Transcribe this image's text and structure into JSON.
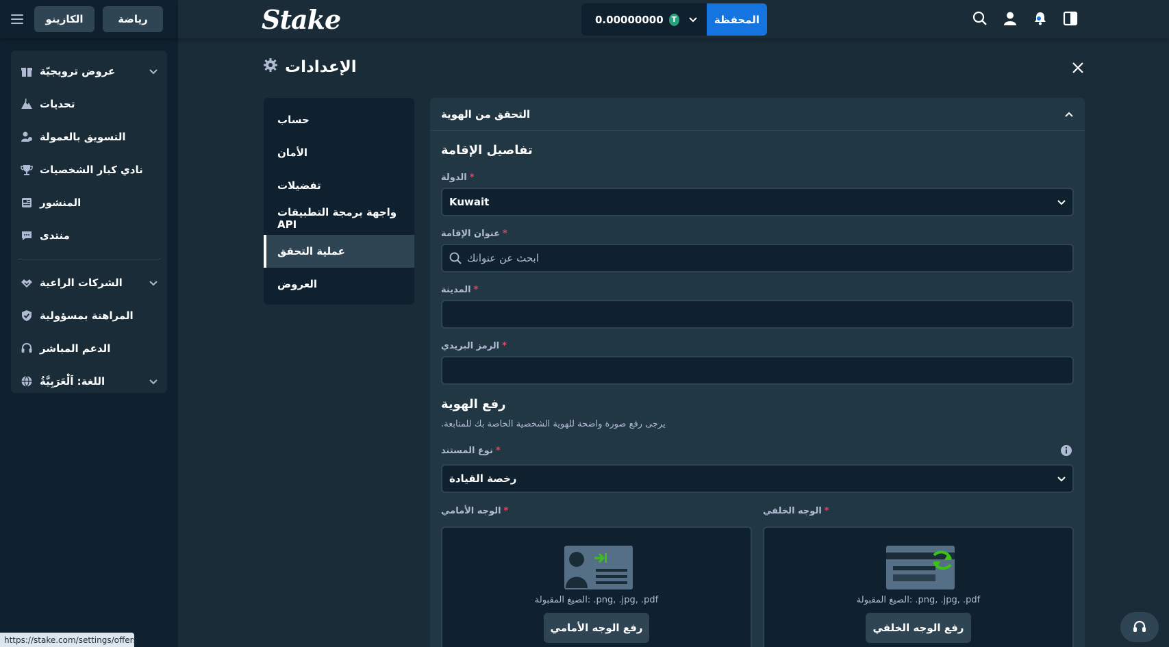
{
  "sidebar": {
    "tabs": {
      "casino": "الكازينو",
      "sports": "رياضة"
    },
    "items": [
      {
        "label": "عروض ترويجيّة",
        "icon": "gift-icon",
        "has_chevron": true
      },
      {
        "label": "تحديات",
        "icon": "mountain-icon",
        "has_chevron": false
      },
      {
        "label": "التسويق بالعمولة",
        "icon": "affiliate-icon",
        "has_chevron": false
      },
      {
        "label": "نادي كبار الشخصيات",
        "icon": "trophy-icon",
        "has_chevron": false
      },
      {
        "label": "المنشور",
        "icon": "newspaper-icon",
        "has_chevron": false
      },
      {
        "label": "منتدى",
        "icon": "chat-icon",
        "has_chevron": false
      }
    ],
    "items2": [
      {
        "label": "الشركات الراعية",
        "icon": "handshake-icon",
        "has_chevron": true
      },
      {
        "label": "المراهنة بمسؤولية",
        "icon": "shield-icon",
        "has_chevron": false
      },
      {
        "label": "الدعم المباشر",
        "icon": "headset-icon",
        "has_chevron": false
      },
      {
        "label": "اللغة: اَلْعَرَبِيَّةُ",
        "icon": "globe-icon",
        "has_chevron": true
      }
    ]
  },
  "header": {
    "logo": "Stake",
    "balance": "0.00000000",
    "currency_icon": "T",
    "wallet_label": "المحفظة"
  },
  "page": {
    "title": "الإعدادات"
  },
  "settings_nav": [
    {
      "label": "حساب",
      "active": false
    },
    {
      "label": "الأمان",
      "active": false
    },
    {
      "label": "تفضيلات",
      "active": false
    },
    {
      "label": "واجهة برمجة التطبيقات API",
      "active": false
    },
    {
      "label": "عملية التحقق",
      "active": true
    },
    {
      "label": "العروض",
      "active": false
    }
  ],
  "verification": {
    "panel_title": "التحقق من الهوية",
    "residence_title": "تفاصيل الإقامة",
    "country_label": "الدولة",
    "country_value": "Kuwait",
    "address_label": "عنوان الإقامة",
    "address_placeholder": "ابحث عن عنوانك",
    "city_label": "المدينة",
    "postal_label": "الرمز البريدي",
    "id_title": "رفع الهوية",
    "id_desc": ".يرجى رفع صورة واضحة للهوية الشخصية الخاصة بك للمتابعة",
    "doctype_label": "نوع المستند",
    "doctype_value": "رخصة القيادة",
    "front_label": "الوجه الأمامي",
    "back_label": "الوجه الخلفي",
    "formats_text": "الصيغ المقبولة: .png, .jpg, .pdf",
    "front_button": "رفع الوجه الأمامي",
    "back_button": "رفع الوجه الخلفي",
    "required_mark": "*"
  },
  "status_bar": {
    "url": "https://stake.com/settings/offers"
  },
  "colors": {
    "bg": "#1a2c38",
    "sidebar": "#0f212e",
    "panel": "#213743",
    "accent_blue": "#1475e1",
    "required_red": "#ed4163",
    "upload_green": "#3bc117"
  }
}
